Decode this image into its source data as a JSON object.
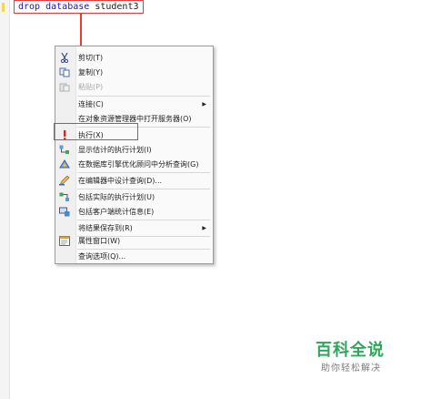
{
  "editor": {
    "sql_keyword_1": "drop",
    "sql_keyword_2": "database",
    "sql_identifier": "student3"
  },
  "context_menu": {
    "items": [
      {
        "label": "剪切(T)",
        "icon": "cut-icon",
        "enabled": true,
        "submenu": false
      },
      {
        "label": "复制(Y)",
        "icon": "copy-icon",
        "enabled": true,
        "submenu": false
      },
      {
        "label": "粘贴(P)",
        "icon": "paste-icon",
        "enabled": false,
        "submenu": false
      },
      {
        "label": "连接(C)",
        "icon": "",
        "enabled": true,
        "submenu": true
      },
      {
        "label": "在对象资源管理器中打开服务器(O)",
        "icon": "",
        "enabled": true,
        "submenu": false
      },
      {
        "label": "执行(X)",
        "icon": "execute-icon",
        "enabled": true,
        "submenu": false
      },
      {
        "label": "显示估计的执行计划(I)",
        "icon": "estimated-plan-icon",
        "enabled": true,
        "submenu": false
      },
      {
        "label": "在数据库引擎优化顾问中分析查询(G)",
        "icon": "tuning-advisor-icon",
        "enabled": true,
        "submenu": false
      },
      {
        "label": "在编辑器中设计查询(D)...",
        "icon": "query-designer-icon",
        "enabled": true,
        "submenu": false
      },
      {
        "label": "包括实际的执行计划(U)",
        "icon": "actual-plan-icon",
        "enabled": true,
        "submenu": false
      },
      {
        "label": "包括客户端统计信息(E)",
        "icon": "client-stats-icon",
        "enabled": true,
        "submenu": false
      },
      {
        "label": "将结果保存到(R)",
        "icon": "",
        "enabled": true,
        "submenu": true
      },
      {
        "label": "属性窗口(W)",
        "icon": "properties-icon",
        "enabled": true,
        "submenu": false
      },
      {
        "label": "查询选项(Q)...",
        "icon": "",
        "enabled": true,
        "submenu": false
      }
    ],
    "submenu_arrow": "▶"
  },
  "watermark": {
    "title": "百科全说",
    "subtitle": "助你轻松解决"
  },
  "colors": {
    "annotation_red": "#e23c3c",
    "sql_keyword_blue": "#1515c8",
    "watermark_green": "#2fa75a"
  }
}
